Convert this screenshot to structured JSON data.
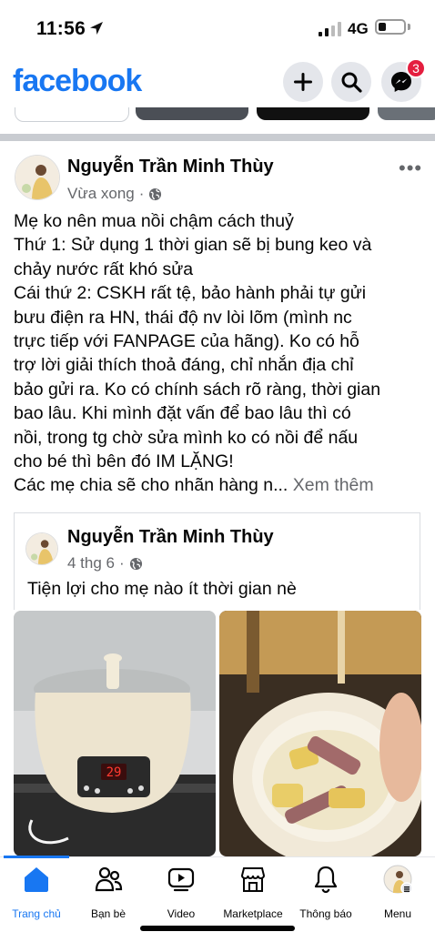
{
  "status": {
    "time": "11:56",
    "network": "4G"
  },
  "header": {
    "logo": "facebook",
    "messenger_badge": "3",
    "icons": [
      "plus-icon",
      "search-icon",
      "messenger-icon"
    ]
  },
  "post": {
    "author": "Nguyễn Trần Minh Thùy",
    "time": "Vừa xong",
    "lines": [
      "Mẹ ko nên mua nồi chậm cách thuỷ",
      "Thứ 1: Sử dụng 1 thời gian sẽ bị bung keo và",
      "chảy nước rất khó sửa",
      "Cái thứ 2: CSKH rất tệ, bảo hành phải tự gửi",
      "bưu điện ra HN, thái độ nv lòi lõm (mình nc",
      "trực tiếp với FANPAGE của hãng). Ko có hỗ",
      "trợ lời giải thích thoả đáng, chỉ nhắn địa chỉ",
      "bảo gửi ra. Ko có chính sách rõ ràng, thời gian",
      "bao lâu. Khi mình đặt vấn để bao lâu thì có",
      "nồi, trong tg chờ sửa mình ko có nồi để nấu",
      "cho bé thì bên đó IM LẶNG!"
    ],
    "last_line": "Các mẹ chia sẽ cho nhãn hàng n...",
    "see_more": "Xem thêm"
  },
  "shared": {
    "author": "Nguyễn Trần Minh Thùy",
    "time": "4 thg 6",
    "text": "Tiện lợi cho mẹ nào ít thời gian nè",
    "cooker_display": "29"
  },
  "tabs": [
    {
      "label": "Trang chủ",
      "icon": "home-icon",
      "active": true
    },
    {
      "label": "Bạn bè",
      "icon": "friends-icon",
      "active": false
    },
    {
      "label": "Video",
      "icon": "video-icon",
      "active": false
    },
    {
      "label": "Marketplace",
      "icon": "marketplace-icon",
      "active": false
    },
    {
      "label": "Thông báo",
      "icon": "bell-icon",
      "active": false
    },
    {
      "label": "Menu",
      "icon": "menu-avatar-icon",
      "active": false
    }
  ],
  "colors": {
    "brand": "#1877f2",
    "badge": "#e41e3f",
    "secondary_text": "#65676b"
  }
}
